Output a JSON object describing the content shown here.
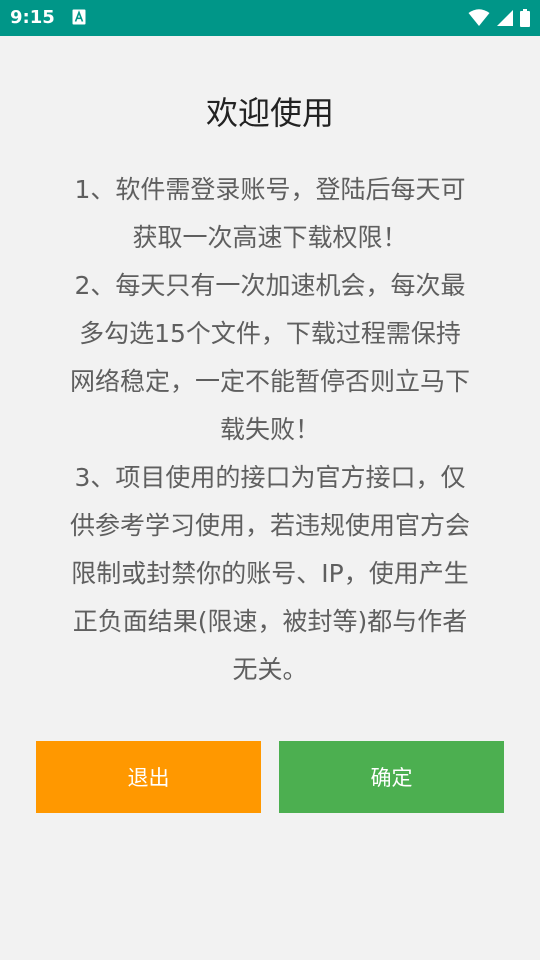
{
  "status_bar": {
    "time": "9:15",
    "background": "#009688",
    "icons": [
      "notification-a-icon",
      "wifi-icon",
      "signal-icon",
      "battery-icon"
    ]
  },
  "dialog": {
    "title": "欢迎使用",
    "message": "1、软件需登录账号，登陆后每天可\n获取一次高速下载权限！\n2、每天只有一次加速机会，每次最\n多勾选15个文件，下载过程需保持\n网络稳定，一定不能暂停否则立马下\n载失败！\n3、项目使用的接口为官方接口，仅\n供参考学习使用，若违规使用官方会\n限制或封禁你的账号、IP，使用产生\n正负面结果(限速，被封等)都与作者\n无关。",
    "buttons": {
      "exit_label": "退出",
      "confirm_label": "确定"
    },
    "colors": {
      "exit": "#ff9800",
      "confirm": "#4caf50",
      "background": "#f2f2f2"
    }
  }
}
